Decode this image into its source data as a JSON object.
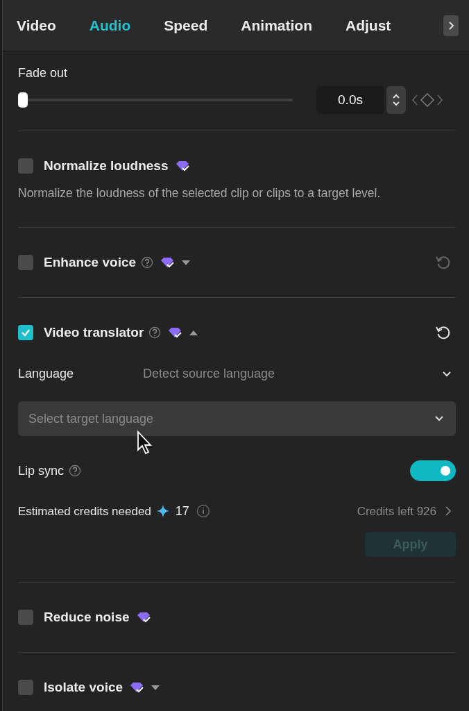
{
  "tabs": [
    {
      "label": "Video",
      "selected": false
    },
    {
      "label": "Audio",
      "selected": true
    },
    {
      "label": "Speed",
      "selected": false
    },
    {
      "label": "Animation",
      "selected": false
    },
    {
      "label": "Adjust",
      "selected": false
    }
  ],
  "fade_out": {
    "label": "Fade out",
    "level": 0,
    "value": "0.0s"
  },
  "sections": [
    {
      "kind": "plain",
      "title": "Normalize loudness",
      "checked": false,
      "help": false,
      "description": "Normalize the loudness of the selected clip or clips to a target level."
    },
    {
      "kind": "plain",
      "title": "Enhance voice",
      "checked": false,
      "help": true,
      "expanded": false,
      "reset_enabled": false
    },
    {
      "kind": "translator",
      "title": "Video translator",
      "checked": true,
      "help": true,
      "expanded": true,
      "reset_enabled": true,
      "language_label": "Language",
      "source_placeholder": "Detect source language",
      "target_placeholder": "Select target language",
      "lip_sync": {
        "label": "Lip sync",
        "on": true
      },
      "credits_label": "Estimated credits needed",
      "credits_value": "17",
      "credits_left": "Credits left 926",
      "apply": {
        "label": "Apply",
        "disabled": true
      }
    },
    {
      "kind": "plain",
      "title": "Reduce noise",
      "checked": false,
      "help": false
    },
    {
      "kind": "plain",
      "title": "Isolate voice",
      "checked": false,
      "help": false,
      "expanded": false
    }
  ]
}
